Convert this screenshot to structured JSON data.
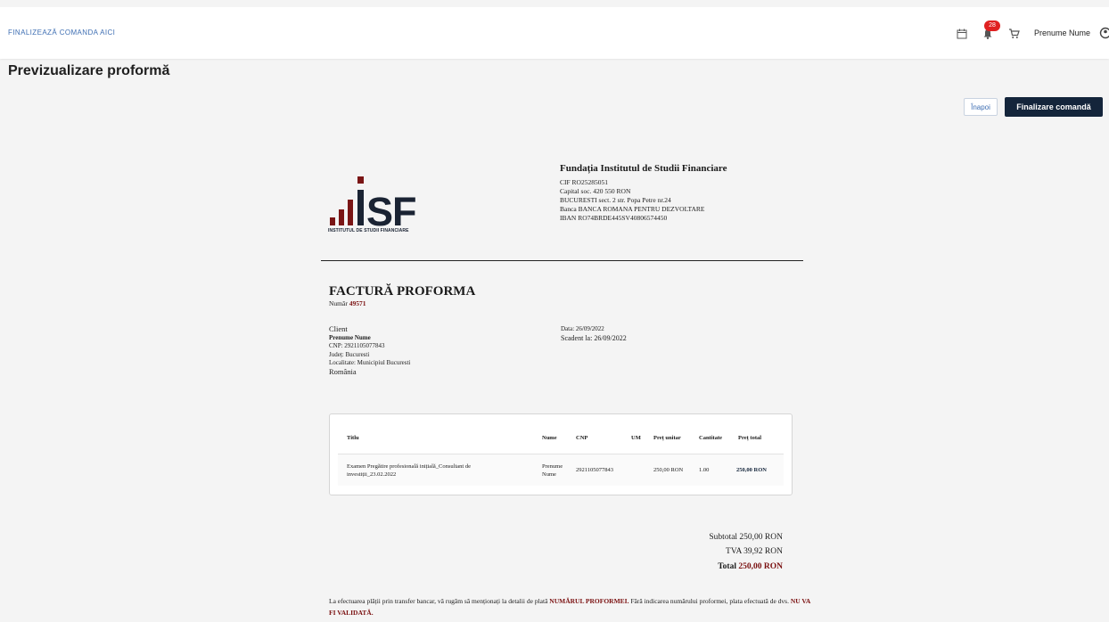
{
  "topbar": {
    "link_label": "FINALIZEAZĂ COMANDA AICI",
    "notif_count": "28",
    "user_name": "Prenume Nume",
    "calendar_icon": "calendar-icon",
    "bell_icon": "bell-icon",
    "cart_icon": "cart-icon",
    "user_icon": "user-icon"
  },
  "page": {
    "title": "Previzualizare proformă",
    "back_label": "Înapoi",
    "finish_label": "Finalizare comandă"
  },
  "colors": {
    "accent": "#14253b",
    "link": "#3f6fb3",
    "badge": "#e02121",
    "highlight": "#7a1010"
  },
  "company": {
    "logo_text": "ISF",
    "logo_caption": "INSTITUTUL DE STUDII FINANCIARE",
    "name": "Fundația Institutul de Studii Financiare",
    "lines": [
      "CIF RO25285051",
      "Capital soc. 420 550 RON",
      "BUCURESTI sect. 2 str. Popa Petre nr.24",
      "Banca BANCA ROMANA PENTRU DEZVOLTARE",
      "IBAN RO74BRDE445SV40806574450"
    ]
  },
  "invoice": {
    "title": "FACTURĂ PROFORMA",
    "number_label": "Număr",
    "number": "49571",
    "client_label": "Client",
    "client_name": "Prenume Nume",
    "client_cnp": "CNP: 2921105077843",
    "client_county": "Județ: Bucuresti",
    "client_city": "Localitate: Municipiul Bucuresti",
    "client_country": "România",
    "date_label": "Data: 26/09/2022",
    "due_label": "Scadent la: 26/09/2022"
  },
  "table": {
    "headers": [
      "Titlu",
      "Nume",
      "CNP",
      "UM",
      "Preț unitar",
      "Cantitate",
      "Preț total"
    ],
    "rows": [
      {
        "title_line1": "Examen Pregătire profesională inițială_Consultant de",
        "title_line2": "investiții_23.02.2022",
        "name_line1": "Prenume",
        "name_line2": "Nume",
        "cnp": "2921105077843",
        "um": "",
        "unit_price": "250,00 RON",
        "qty": "1.00",
        "total": "250,00 RON"
      }
    ]
  },
  "totals": {
    "subtotal": "Subtotal 250,00 RON",
    "tva": "TVA 39,92 RON",
    "total_label": "Total",
    "total_value": "250,00 RON"
  },
  "note": {
    "part1": "La efectuarea plății prin transfer bancar, vă rugăm să menționați la detalii de plată ",
    "bold1": "NUMĂRUL PROFORMEI.",
    "part2": " Fără indicarea numărului proformei, plata efectuată de dvs. ",
    "bold2": "NU VA FI VALIDATĂ."
  }
}
